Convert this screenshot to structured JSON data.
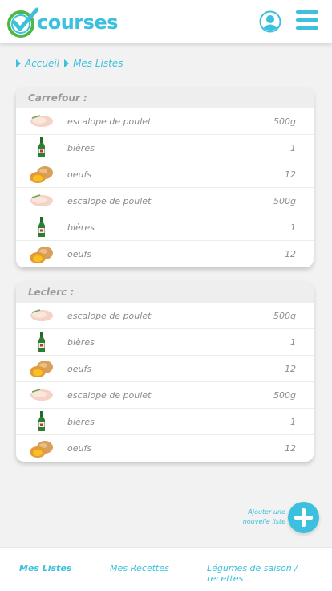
{
  "header": {
    "logo_text": "courses",
    "brand_color": "#3dc0dd",
    "logo_check_color": "#4cb848",
    "user_icon": "user-circle-icon",
    "menu_icon": "hamburger-menu-icon"
  },
  "breadcrumb": {
    "items": [
      "Accueil",
      "Mes Listes"
    ]
  },
  "lists": [
    {
      "title": "Carrefour :",
      "items": [
        {
          "icon": "chicken-breast-icon",
          "name": "escalope de poulet",
          "qty": "500g"
        },
        {
          "icon": "beer-bottle-icon",
          "name": "bières",
          "qty": "1"
        },
        {
          "icon": "eggs-icon",
          "name": "oeufs",
          "qty": "12"
        },
        {
          "icon": "chicken-breast-icon",
          "name": "escalope de poulet",
          "qty": "500g"
        },
        {
          "icon": "beer-bottle-icon",
          "name": "bières",
          "qty": "1"
        },
        {
          "icon": "eggs-icon",
          "name": "oeufs",
          "qty": "12"
        }
      ]
    },
    {
      "title": "Leclerc :",
      "items": [
        {
          "icon": "chicken-breast-icon",
          "name": "escalope de poulet",
          "qty": "500g"
        },
        {
          "icon": "beer-bottle-icon",
          "name": "bières",
          "qty": "1"
        },
        {
          "icon": "eggs-icon",
          "name": "oeufs",
          "qty": "12"
        },
        {
          "icon": "chicken-breast-icon",
          "name": "escalope de poulet",
          "qty": "500g"
        },
        {
          "icon": "beer-bottle-icon",
          "name": "bières",
          "qty": "1"
        },
        {
          "icon": "eggs-icon",
          "name": "oeufs",
          "qty": "12"
        }
      ]
    }
  ],
  "add_list": {
    "label_line1": "Ajouter une",
    "label_line2": "nouvelle liste",
    "icon": "plus-icon"
  },
  "bottom_nav": {
    "items": [
      {
        "label": "Mes Listes",
        "active": true
      },
      {
        "label": "Mes Recettes",
        "active": false
      },
      {
        "label": "Légumes de saison / recettes",
        "active": false
      }
    ]
  }
}
